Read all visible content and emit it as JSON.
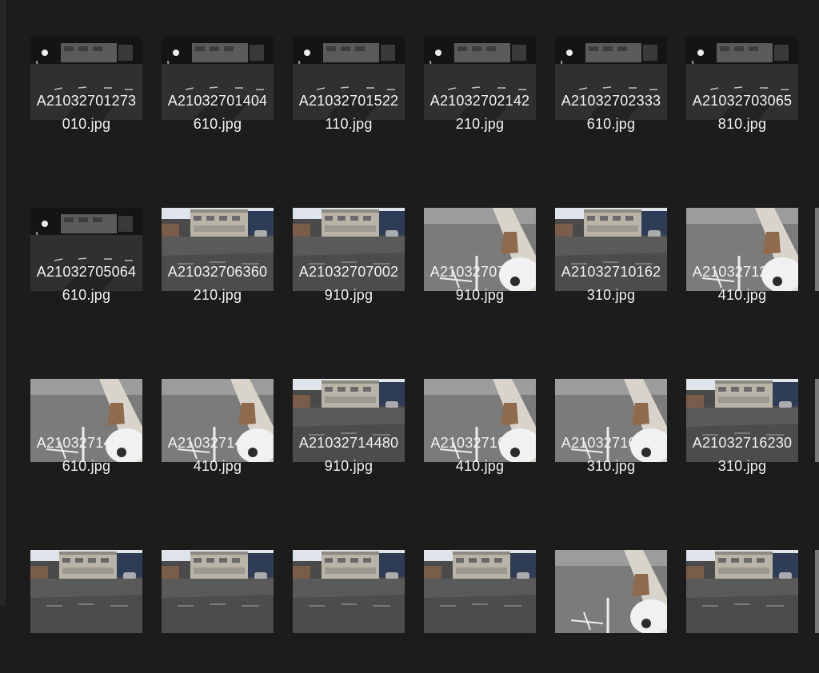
{
  "files": [
    {
      "line1": "A21032701273",
      "line2": "010.jpg",
      "scene": "night"
    },
    {
      "line1": "A21032701404",
      "line2": "610.jpg",
      "scene": "night"
    },
    {
      "line1": "A21032701522",
      "line2": "110.jpg",
      "scene": "night"
    },
    {
      "line1": "A21032702142",
      "line2": "210.jpg",
      "scene": "night"
    },
    {
      "line1": "A21032702333",
      "line2": "610.jpg",
      "scene": "night"
    },
    {
      "line1": "A21032703065",
      "line2": "810.jpg",
      "scene": "night"
    },
    {
      "line1": "A21032705064",
      "line2": "610.jpg",
      "scene": "night"
    },
    {
      "line1": "A21032706360",
      "line2": "210.jpg",
      "scene": "lot"
    },
    {
      "line1": "A21032707002",
      "line2": "910.jpg",
      "scene": "lot"
    },
    {
      "line1": "A21032707533",
      "line2": "910.jpg",
      "scene": "close"
    },
    {
      "line1": "A21032710162",
      "line2": "310.jpg",
      "scene": "lot"
    },
    {
      "line1": "A21032712281",
      "line2": "410.jpg",
      "scene": "close"
    },
    {
      "line1": "A21032714135",
      "line2": "610.jpg",
      "scene": "close"
    },
    {
      "line1": "A21032714152",
      "line2": "410.jpg",
      "scene": "close"
    },
    {
      "line1": "A21032714480",
      "line2": "910.jpg",
      "scene": "lot"
    },
    {
      "line1": "A21032716211",
      "line2": "410.jpg",
      "scene": "close"
    },
    {
      "line1": "A21032716222",
      "line2": "310.jpg",
      "scene": "close"
    },
    {
      "line1": "A21032716230",
      "line2": "310.jpg",
      "scene": "lot"
    },
    {
      "line1": "",
      "line2": "",
      "scene": "lot"
    },
    {
      "line1": "",
      "line2": "",
      "scene": "lot"
    },
    {
      "line1": "",
      "line2": "",
      "scene": "lot"
    },
    {
      "line1": "",
      "line2": "",
      "scene": "lot"
    },
    {
      "line1": "",
      "line2": "",
      "scene": "close"
    },
    {
      "line1": "",
      "line2": "",
      "scene": "lot"
    }
  ],
  "colors": {
    "background": "#1c1c1c",
    "filename_text": "#f2f2f2"
  }
}
